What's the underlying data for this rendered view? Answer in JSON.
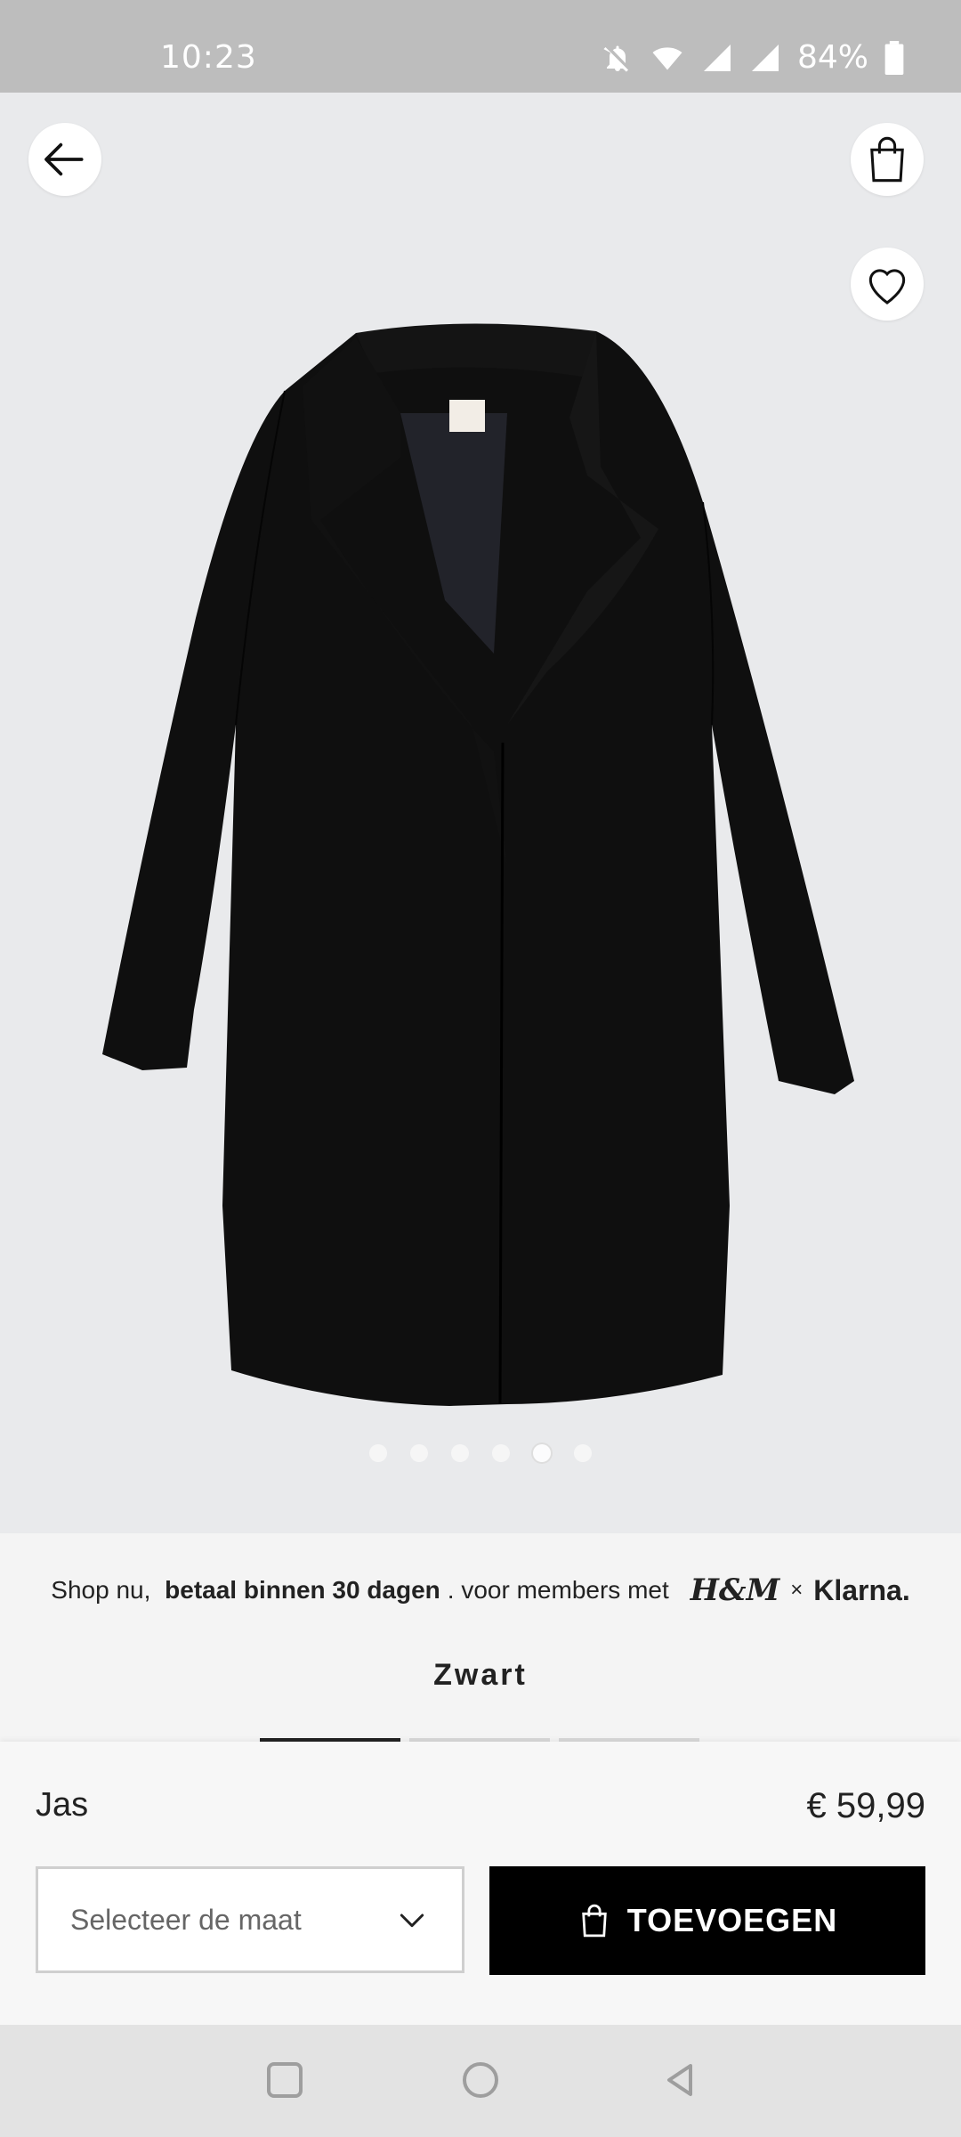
{
  "status_bar": {
    "time": "10:23",
    "battery": "84%",
    "icons": [
      "bell-off-icon",
      "wifi-icon",
      "signal-icon",
      "signal-icon",
      "battery-icon"
    ]
  },
  "hero": {
    "image_description": "black-coat-image",
    "carousel": {
      "count": 6,
      "active_index": 4
    }
  },
  "actions": {
    "back_icon": "arrow-left-icon",
    "bag_icon": "shopping-bag-icon",
    "favorite_icon": "heart-icon"
  },
  "promo": {
    "prefix": "Shop nu, ",
    "bold": "betaal binnen 30 dagen",
    "suffix": ". voor members met",
    "brand": "H&M",
    "times": "×",
    "partner": "Klarna."
  },
  "variant": {
    "color_name": "Zwart",
    "swatches": 3,
    "active_swatch": 0
  },
  "product": {
    "name": "Jas",
    "price": "€ 59,99"
  },
  "size_select": {
    "placeholder": "Selecteer de maat"
  },
  "add_button": {
    "label": "TOEVOEGEN"
  },
  "colors": {
    "accent": "#000000",
    "background": "#e9eaec"
  }
}
